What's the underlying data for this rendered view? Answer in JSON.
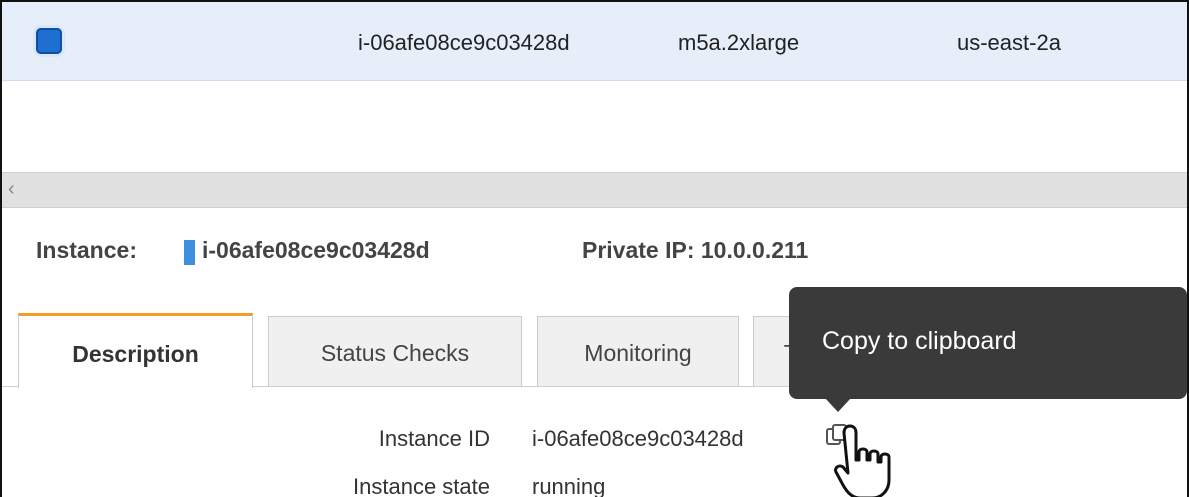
{
  "instances_table": {
    "selected_row": {
      "instance_id": "i-06afe08ce9c03428d",
      "instance_type": "m5a.2xlarge",
      "availability_zone": "us-east-2a",
      "checkbox_icon": "checkbox-checked-icon"
    }
  },
  "scrollbar": {
    "left_arrow": "‹"
  },
  "details_header": {
    "instance_label": "Instance:",
    "instance_id": "i-06afe08ce9c03428d",
    "private_ip_label": "Private IP: 10.0.0.211"
  },
  "tabs": [
    {
      "label": "Description",
      "active": true
    },
    {
      "label": "Status Checks",
      "active": false
    },
    {
      "label": "Monitoring",
      "active": false
    },
    {
      "label": "Tags",
      "active": false
    }
  ],
  "tooltip": {
    "text": "Copy to clipboard"
  },
  "details": [
    {
      "label": "Instance ID",
      "value": "i-06afe08ce9c03428d"
    },
    {
      "label": "Instance state",
      "value": "running"
    }
  ],
  "icons": {
    "copy": "copy-to-clipboard-icon",
    "cursor": "hand-pointer-cursor-icon"
  },
  "colors": {
    "selected_row_bg": "#e6eefa",
    "checkbox": "#1f6fd1",
    "active_tab_accent": "#f39c26",
    "tooltip_bg": "#3a3a3a",
    "instance_marker": "#3f8fe0"
  }
}
